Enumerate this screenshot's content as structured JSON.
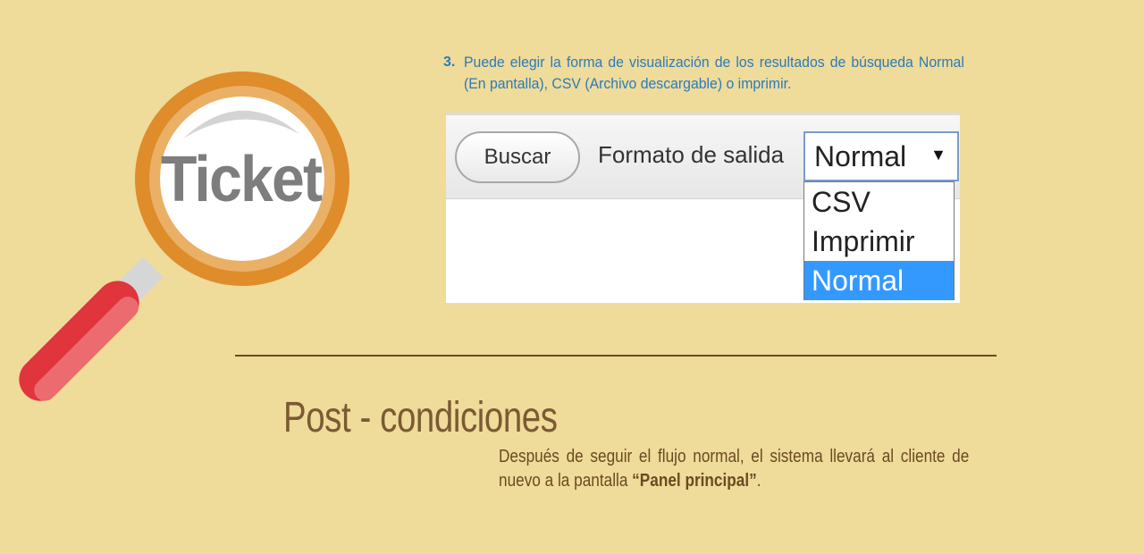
{
  "logo": {
    "word": "Ticket",
    "icon": "magnifying-glass-icon",
    "colors": {
      "ring": "#df8c2a",
      "ring_light": "#eab066",
      "handle": "#e0353c",
      "lens": "#ffffff",
      "text": "#7d7d7d"
    }
  },
  "step": {
    "number": "3.",
    "text": "Puede elegir la forma de visualización de los resultados de búsqueda Normal (En pantalla), CSV (Archivo descargable) o imprimir."
  },
  "screenshot": {
    "search_button": "Buscar",
    "format_label": "Formato de salida",
    "select": {
      "selected": "Normal",
      "arrow": "▼",
      "options": [
        {
          "label": "CSV"
        },
        {
          "label": "Imprimir"
        },
        {
          "label": "Normal"
        }
      ]
    }
  },
  "post": {
    "title": "Post - condiciones",
    "text_before": "Después de seguir el flujo normal, el sistema llevará al cliente de nuevo a la pantalla ",
    "highlight": "“Panel principal”",
    "text_after": "."
  },
  "colors": {
    "background": "#efdb9a",
    "step_text": "#2a7bbd",
    "title": "#7a5a33",
    "body": "#6b4a22",
    "dropdown_highlight": "#3399ff"
  }
}
